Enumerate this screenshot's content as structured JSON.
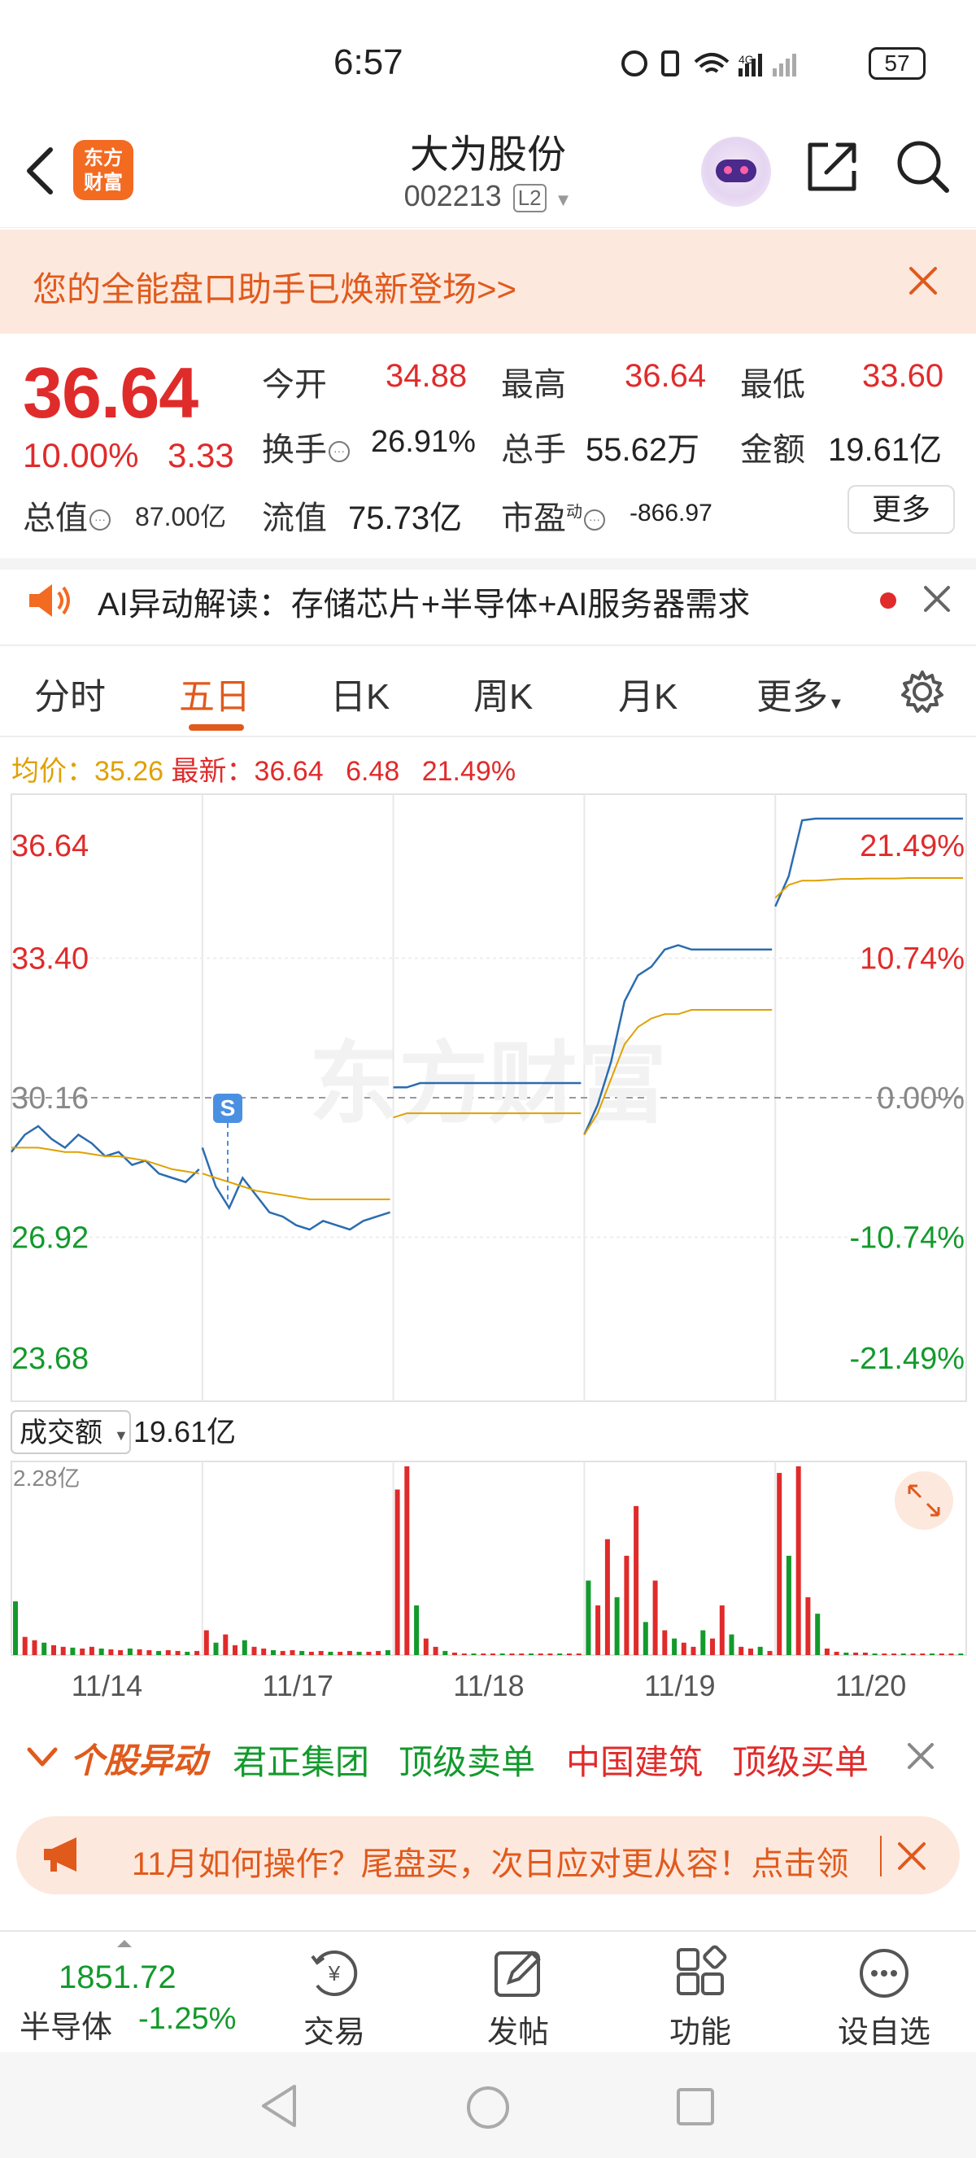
{
  "status_bar": {
    "time": "6:57",
    "battery": "57",
    "network": "4G"
  },
  "header": {
    "logo_line1": "东方",
    "logo_line2": "财富",
    "stock_name": "大为股份",
    "stock_code": "002213",
    "level": "L2"
  },
  "promo": {
    "text": "您的全能盘口助手已焕新登场>>"
  },
  "quote": {
    "price": "36.64",
    "change_pct": "10.00%",
    "change_abs": "3.33",
    "open_label": "今开",
    "open": "34.88",
    "high_label": "最高",
    "high": "36.64",
    "low_label": "最低",
    "low": "33.60",
    "turnover_label": "换手",
    "turnover": "26.91%",
    "volume_label": "总手",
    "volume": "55.62万",
    "amount_label": "金额",
    "amount": "19.61亿",
    "mktcap_label": "总值",
    "mktcap": "87.00亿",
    "float_label": "流值",
    "float_cap": "75.73亿",
    "pe_label": "市盈",
    "pe_sup": "动",
    "pe": "-866.97",
    "more_label": "更多"
  },
  "ai": {
    "text": "AI异动解读：存储芯片+半导体+AI服务器需求"
  },
  "tabs": [
    "分时",
    "五日",
    "日K",
    "周K",
    "月K",
    "更多"
  ],
  "info_line": {
    "avg_label": "均价：",
    "avg": "35.26",
    "latest_label": "最新：",
    "latest": "36.64",
    "change": "6.48",
    "pct": "21.49%"
  },
  "chart_data": {
    "type": "line",
    "title": "",
    "y_left_ticks": [
      "36.64",
      "33.40",
      "30.16",
      "26.92",
      "23.68"
    ],
    "y_right_ticks": [
      "21.49%",
      "10.74%",
      "0.00%",
      "-10.74%",
      "-21.49%"
    ],
    "ylim": [
      23.68,
      36.64
    ],
    "x_labels": [
      "11/14",
      "11/17",
      "11/18",
      "11/19",
      "11/20"
    ],
    "series": [
      {
        "name": "",
        "color": "#2b6cb0",
        "values": [
          28.9,
          29.3,
          29.5,
          29.2,
          29.0,
          29.3,
          29.1,
          28.8,
          28.9,
          28.6,
          28.7,
          28.4,
          28.3,
          28.2,
          28.5,
          29.0,
          28.1,
          27.6,
          28.3,
          27.9,
          27.5,
          27.4,
          27.2,
          27.1,
          27.3,
          27.2,
          27.1,
          27.3,
          27.4,
          27.5,
          30.4,
          30.4,
          30.5,
          30.5,
          30.5,
          30.5,
          30.5,
          30.5,
          30.5,
          30.5,
          30.5,
          30.5,
          30.5,
          30.5,
          30.5,
          29.3,
          30.0,
          31.0,
          32.4,
          33.0,
          33.2,
          33.6,
          33.7,
          33.6,
          33.6,
          33.6,
          33.6,
          33.6,
          33.6,
          33.6,
          34.6,
          35.3,
          36.6,
          36.64,
          36.64,
          36.64,
          36.64,
          36.64,
          36.64,
          36.64,
          36.64,
          36.64,
          36.64,
          36.64,
          36.64
        ]
      },
      {
        "name": "",
        "color": "#e0a100",
        "values": [
          29.0,
          29.0,
          29.0,
          28.95,
          28.9,
          28.9,
          28.85,
          28.8,
          28.8,
          28.75,
          28.7,
          28.6,
          28.5,
          28.45,
          28.4,
          28.4,
          28.3,
          28.2,
          28.1,
          28.0,
          27.95,
          27.9,
          27.85,
          27.8,
          27.8,
          27.8,
          27.8,
          27.8,
          27.8,
          27.8,
          29.7,
          29.8,
          29.8,
          29.8,
          29.8,
          29.8,
          29.8,
          29.8,
          29.8,
          29.8,
          29.8,
          29.8,
          29.8,
          29.8,
          29.8,
          29.3,
          29.8,
          30.6,
          31.4,
          31.8,
          32.0,
          32.1,
          32.1,
          32.2,
          32.2,
          32.2,
          32.2,
          32.2,
          32.2,
          32.2,
          34.8,
          35.1,
          35.2,
          35.2,
          35.22,
          35.24,
          35.24,
          35.25,
          35.25,
          35.25,
          35.26,
          35.26,
          35.26,
          35.26,
          35.26
        ]
      }
    ],
    "volume": {
      "label": "成交额",
      "total": "19.61亿",
      "max_label": "2.28亿",
      "max": 2.28,
      "values": [
        0.65,
        0.22,
        0.18,
        0.15,
        0.12,
        0.1,
        0.09,
        0.08,
        0.1,
        0.08,
        0.07,
        0.06,
        0.08,
        0.07,
        0.06,
        0.05,
        0.06,
        0.05,
        0.04,
        0.05,
        0.3,
        0.15,
        0.25,
        0.12,
        0.18,
        0.1,
        0.08,
        0.06,
        0.05,
        0.06,
        0.05,
        0.04,
        0.05,
        0.04,
        0.04,
        0.05,
        0.04,
        0.04,
        0.05,
        0.06,
        2.0,
        2.28,
        0.6,
        0.2,
        0.1,
        0.05,
        0.03,
        0.02,
        0.02,
        0.02,
        0.02,
        0.02,
        0.02,
        0.02,
        0.02,
        0.02,
        0.02,
        0.02,
        0.02,
        0.02,
        0.9,
        0.6,
        1.4,
        0.7,
        1.2,
        1.8,
        0.4,
        0.9,
        0.3,
        0.2,
        0.15,
        0.1,
        0.3,
        0.2,
        0.6,
        0.25,
        0.1,
        0.08,
        0.1,
        0.05,
        2.2,
        1.2,
        2.28,
        0.7,
        0.5,
        0.08,
        0.04,
        0.03,
        0.03,
        0.03,
        0.02,
        0.02,
        0.02,
        0.02,
        0.02,
        0.02,
        0.02,
        0.02,
        0.02,
        0.02
      ]
    }
  },
  "signals": {
    "title": "个股异动",
    "items": [
      {
        "text": "君正集团",
        "color": "#139a2c"
      },
      {
        "text": "顶级卖单",
        "color": "#139a2c"
      },
      {
        "text": "中国建筑",
        "color": "#e02b2b"
      },
      {
        "text": "顶级买单",
        "color": "#e02b2b"
      }
    ]
  },
  "op_banner": {
    "text": "11月如何操作？尾盘买，次日应对更从容！点击领"
  },
  "toolbar": {
    "index_value": "1851.72",
    "index_name": "半导体",
    "index_pct": "-1.25%",
    "items": [
      "交易",
      "发帖",
      "功能",
      "设自选"
    ]
  }
}
